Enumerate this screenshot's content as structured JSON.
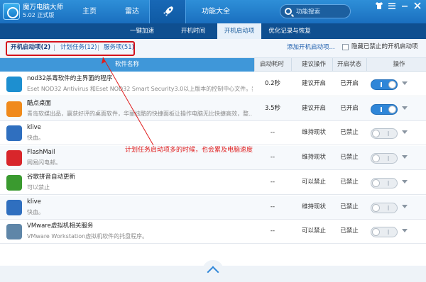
{
  "app": {
    "title": "魔万电脑大师",
    "version": "5.02 正式版"
  },
  "nav": {
    "home": "主页",
    "radar": "雷达",
    "features": "功能大全"
  },
  "search": {
    "placeholder": "功能搜索"
  },
  "window_controls": [
    "shirt-icon",
    "menu-icon",
    "minimize-icon",
    "close-icon"
  ],
  "subnav": {
    "items": [
      "一键加速",
      "开机时间",
      "开机启动项",
      "优化记录与恢复"
    ],
    "active": "开机启动项"
  },
  "filter": {
    "tabs": [
      "开机启动项(2)",
      "计划任务(12)",
      "服务项(51)"
    ],
    "add_link": "添加开机启动项...",
    "hide_label": "隐藏已禁止的开机启动项"
  },
  "table": {
    "headers": {
      "name": "软件名称",
      "time": "启动耗时",
      "advice": "建议操作",
      "status": "开启状态",
      "action": "操作"
    },
    "rows": [
      {
        "name": "nod32杀毒软件的主界面的程序",
        "desc": "Eset NOD32 Antivirus 和Eset NOD32 Smart Security3.0以上版本的控制中心文件。禁...",
        "time": "0.2秒",
        "advice": "建议开启",
        "status": "已开启",
        "on": true,
        "icon": "nod32-icon",
        "color": "#1d8fd0"
      },
      {
        "name": "酷点桌面",
        "desc": "青岛软媒出品，赢获好评的桌面软件，华丽炫酷的快捷面板让操作电脑无比快捷高效，整...",
        "time": "3.5秒",
        "advice": "建议开启",
        "status": "已开启",
        "on": true,
        "icon": "kudian-icon",
        "color": "#f08a1c"
      },
      {
        "name": "klive",
        "desc": "快血。",
        "time": "--",
        "advice": "维持现状",
        "status": "已禁止",
        "on": false,
        "icon": "klive-icon",
        "color": "#2f6fbf"
      },
      {
        "name": "FlashMail",
        "desc": "网易闪电邮。",
        "time": "--",
        "advice": "维持现状",
        "status": "已禁止",
        "on": false,
        "icon": "flashmail-icon",
        "color": "#d8262b"
      },
      {
        "name": "谷歌拼音自动更新",
        "desc": "可以禁止",
        "time": "--",
        "advice": "可以禁止",
        "status": "已禁止",
        "on": false,
        "icon": "download-icon",
        "color": "#3a9a2f"
      },
      {
        "name": "klive",
        "desc": "快血。",
        "time": "--",
        "advice": "维持现状",
        "status": "已禁止",
        "on": false,
        "icon": "klive-icon",
        "color": "#2f6fbf"
      },
      {
        "name": "VMware虚拟机相关服务",
        "desc": "VMware Workstation虚拟机软件的托盘程序。",
        "time": "--",
        "advice": "可以禁止",
        "status": "已禁止",
        "on": false,
        "icon": "vmware-icon",
        "color": "#5f86a8"
      }
    ]
  },
  "annotation": {
    "text": "计划任务启动项多的时候，也会累及电脑速度",
    "color": "#e01d1d"
  },
  "colors": {
    "titlebar": "#1a6fbf",
    "subnav": "#0f4f90",
    "accent": "#2f86d8",
    "highlight": "#d4121c"
  }
}
